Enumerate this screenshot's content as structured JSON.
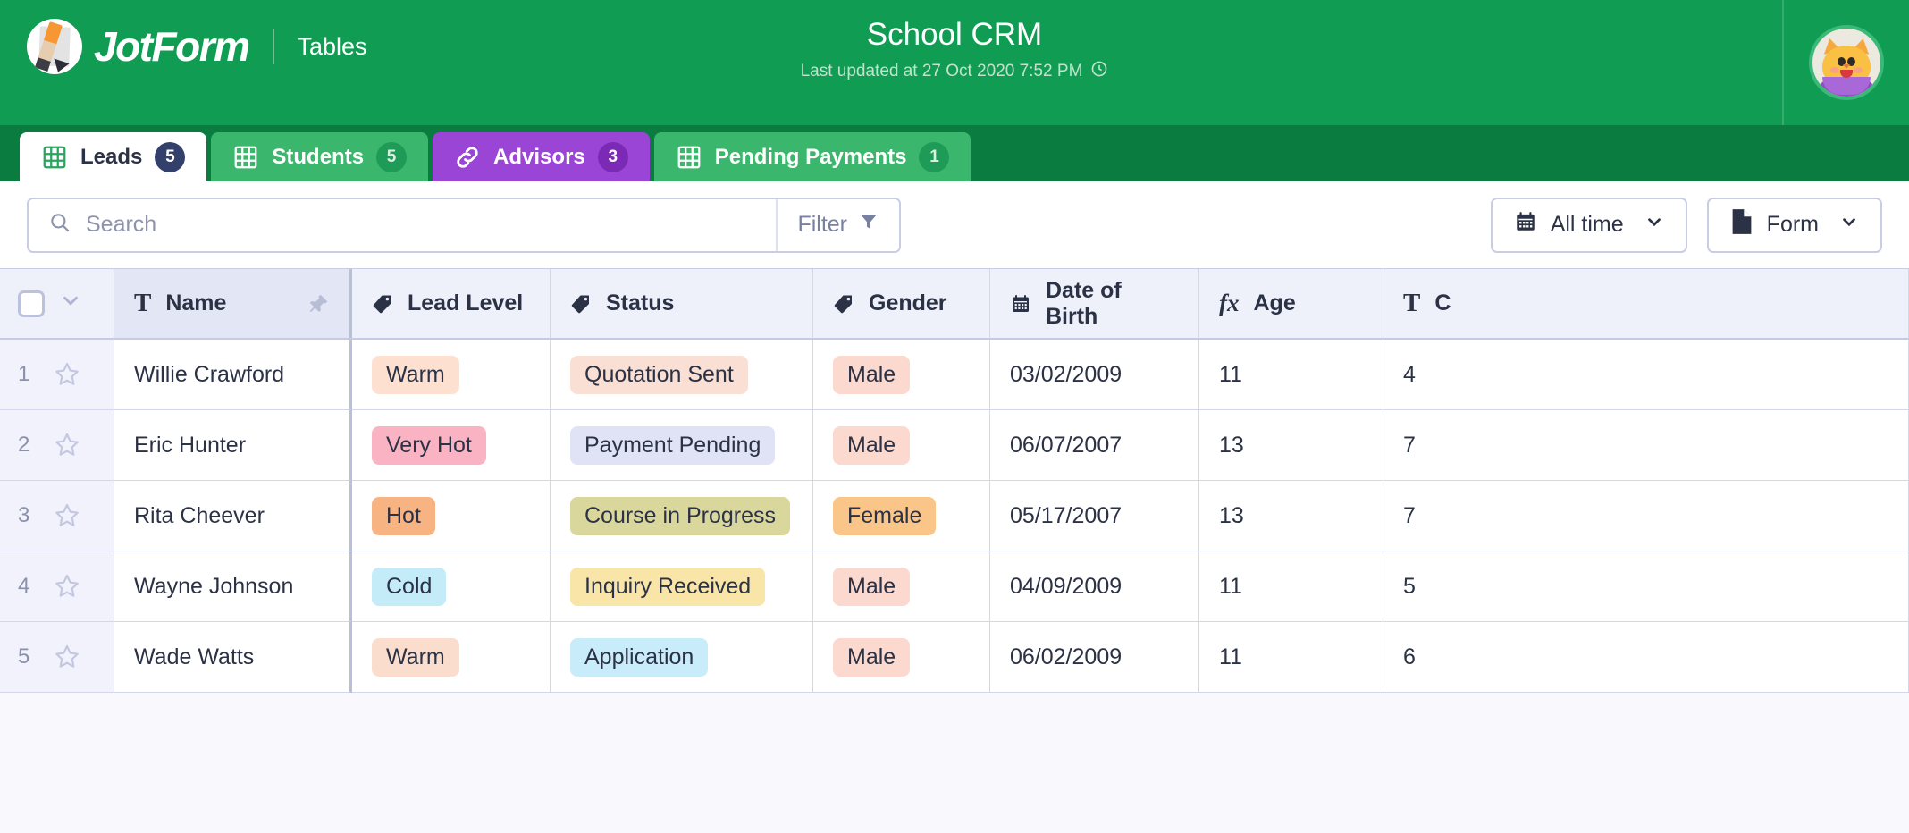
{
  "header": {
    "brand_name": "JotForm",
    "brand_section": "Tables",
    "form_title": "School CRM",
    "last_updated": "Last updated at 27 Oct 2020 7:52 PM",
    "accent_green": "#119c53",
    "tabbar_green": "#0b7c40",
    "avatar_alt": "cat-avatar"
  },
  "tabs": [
    {
      "label": "Leads",
      "count": "5",
      "icon": "grid-icon",
      "state": "active",
      "color": "#ffffff"
    },
    {
      "label": "Students",
      "count": "5",
      "icon": "grid-icon",
      "state": "inactive",
      "color": "#3bb76d"
    },
    {
      "label": "Advisors",
      "count": "3",
      "icon": "link-icon",
      "state": "inactive",
      "color": "#9b45d6"
    },
    {
      "label": "Pending Payments",
      "count": "1",
      "icon": "grid-icon",
      "state": "inactive",
      "color": "#3bb76d"
    }
  ],
  "toolbar": {
    "search_placeholder": "Search",
    "search_value": "",
    "search_icon": "search-icon",
    "filter_label": "Filter",
    "filter_icon": "funnel-icon",
    "date_range_label": "All time",
    "date_range_icon": "calendar-icon",
    "source_label": "Form",
    "source_icon": "document-icon"
  },
  "table": {
    "columns": [
      {
        "label": "Name",
        "type_icon": "text-type-icon",
        "pinned": true
      },
      {
        "label": "Lead Level",
        "type_icon": "tag-type-icon"
      },
      {
        "label": "Status",
        "type_icon": "tag-type-icon"
      },
      {
        "label": "Gender",
        "type_icon": "tag-type-icon"
      },
      {
        "label": "Date of Birth",
        "type_icon": "calendar-type-icon"
      },
      {
        "label": "Age",
        "type_icon": "formula-type-icon"
      },
      {
        "label": "C",
        "type_icon": "text-type-icon"
      }
    ],
    "rows": [
      {
        "index": "1",
        "name": "Willie Crawford",
        "lead_level": {
          "text": "Warm",
          "bg": "#fde0d0"
        },
        "status": {
          "text": "Quotation Sent",
          "bg": "#fadfd4"
        },
        "gender": {
          "text": "Male",
          "bg": "#fcd9cf"
        },
        "dob": "03/02/2009",
        "age": "11",
        "last": "4"
      },
      {
        "index": "2",
        "name": "Eric Hunter",
        "lead_level": {
          "text": "Very Hot",
          "bg": "#f9b3c3"
        },
        "status": {
          "text": "Payment Pending",
          "bg": "#dfe3f5"
        },
        "gender": {
          "text": "Male",
          "bg": "#fcd9cf"
        },
        "dob": "06/07/2007",
        "age": "13",
        "last": "7"
      },
      {
        "index": "3",
        "name": "Rita Cheever",
        "lead_level": {
          "text": "Hot",
          "bg": "#f8b383"
        },
        "status": {
          "text": "Course in Progress",
          "bg": "#d9d79b"
        },
        "gender": {
          "text": "Female",
          "bg": "#f9c588"
        },
        "dob": "05/17/2007",
        "age": "13",
        "last": "7"
      },
      {
        "index": "4",
        "name": "Wayne Johnson",
        "lead_level": {
          "text": "Cold",
          "bg": "#c4ebf8"
        },
        "status": {
          "text": "Inquiry Received",
          "bg": "#fae5a8"
        },
        "gender": {
          "text": "Male",
          "bg": "#fcd9cf"
        },
        "dob": "04/09/2009",
        "age": "11",
        "last": "5"
      },
      {
        "index": "5",
        "name": "Wade Watts",
        "lead_level": {
          "text": "Warm",
          "bg": "#fbddcd"
        },
        "status": {
          "text": "Application",
          "bg": "#c9ecfa"
        },
        "gender": {
          "text": "Male",
          "bg": "#fcd9cf"
        },
        "dob": "06/02/2009",
        "age": "11",
        "last": "6"
      }
    ]
  }
}
